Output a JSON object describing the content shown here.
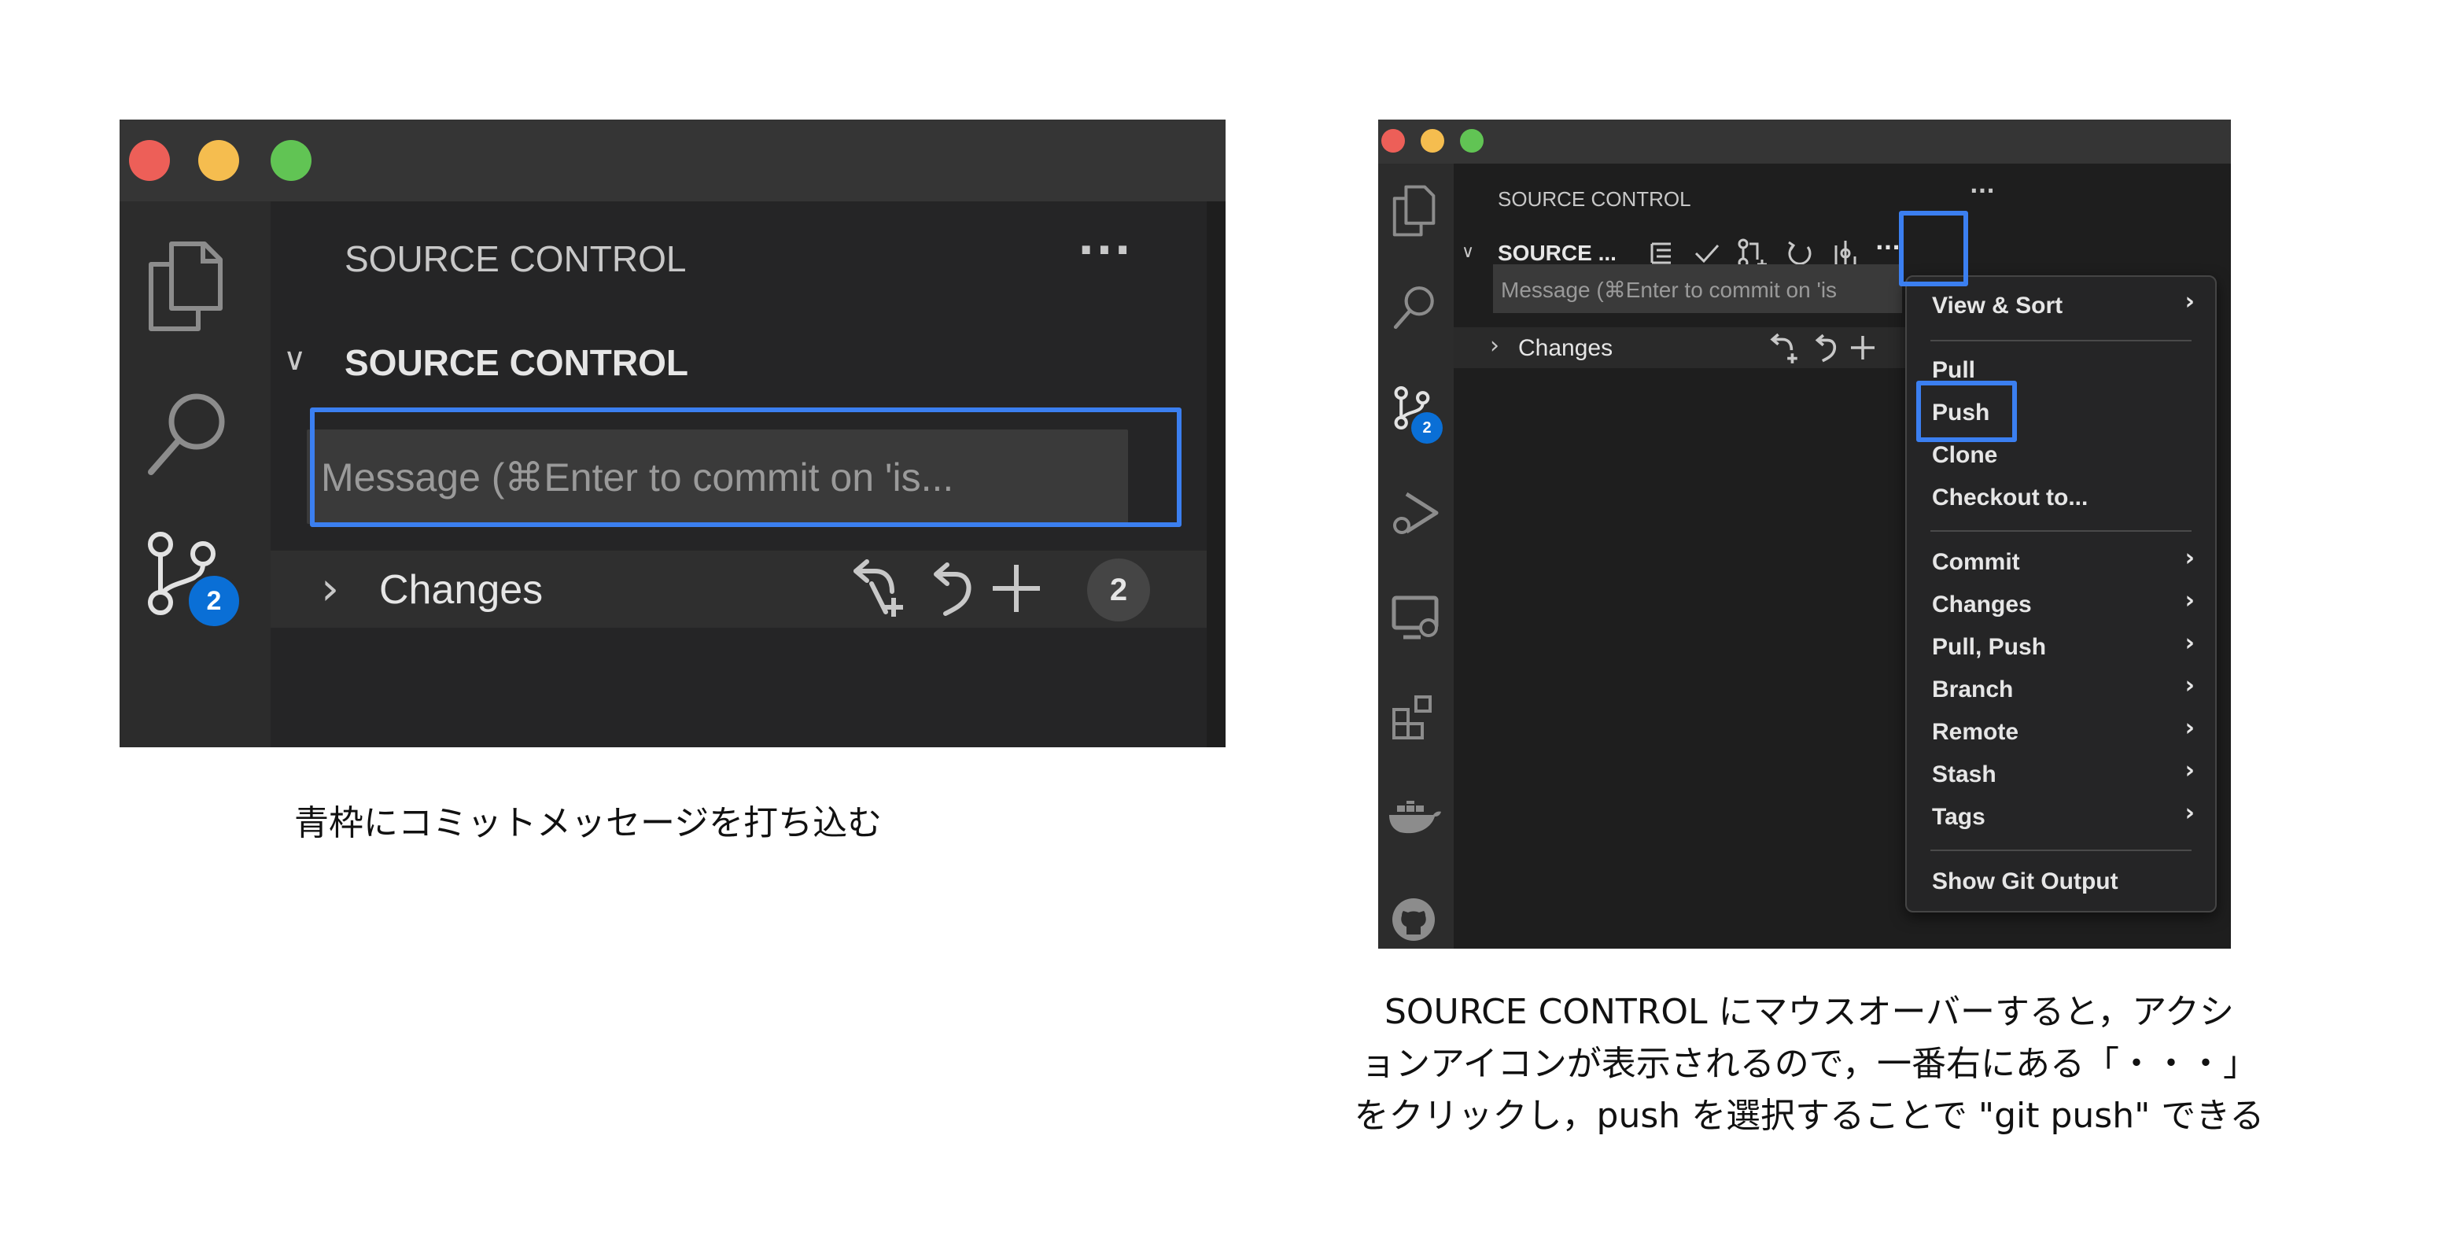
{
  "left": {
    "panel_title": "SOURCE CONTROL",
    "more_label": "···",
    "section_title": "SOURCE CONTROL",
    "section_chevron": "∨",
    "message_placeholder": "Message (⌘Enter to commit on 'is...",
    "changes_chevron": "›",
    "changes_label": "Changes",
    "changes_count": "2",
    "scm_badge": "2"
  },
  "left_caption": "青枠にコミットメッセージを打ち込む",
  "right": {
    "panel_title": "SOURCE CONTROL",
    "panel_more": "···",
    "section_chevron": "∨",
    "section_title": "SOURCE ...",
    "more_label": "···",
    "message_placeholder": "Message (⌘Enter to commit on 'is",
    "changes_chevron": "›",
    "changes_label": "Changes",
    "scm_badge": "2"
  },
  "menu": {
    "items": [
      {
        "label": "View & Sort",
        "submenu": "›"
      },
      {
        "label": "Pull"
      },
      {
        "label": "Push"
      },
      {
        "label": "Clone"
      },
      {
        "label": "Checkout to..."
      },
      {
        "label": "Commit",
        "submenu": "›"
      },
      {
        "label": "Changes",
        "submenu": "›"
      },
      {
        "label": "Pull, Push",
        "submenu": "›"
      },
      {
        "label": "Branch",
        "submenu": "›"
      },
      {
        "label": "Remote",
        "submenu": "›"
      },
      {
        "label": "Stash",
        "submenu": "›"
      },
      {
        "label": "Tags",
        "submenu": "›"
      },
      {
        "label": "Show Git Output"
      }
    ]
  },
  "right_caption": {
    "line1": "SOURCE CONTROL にマウスオーバーすると，アクシ",
    "line2": "ョンアイコンが表示されるので，一番右にある「・・・」",
    "line3": "をクリックし，push を選択することで \"git push\" できる"
  },
  "colors": {
    "highlight": "#3b7ff0",
    "badge": "#0a6fd6",
    "close": "#ed5f58",
    "minimize": "#f5bd4f",
    "zoom": "#61c454"
  }
}
